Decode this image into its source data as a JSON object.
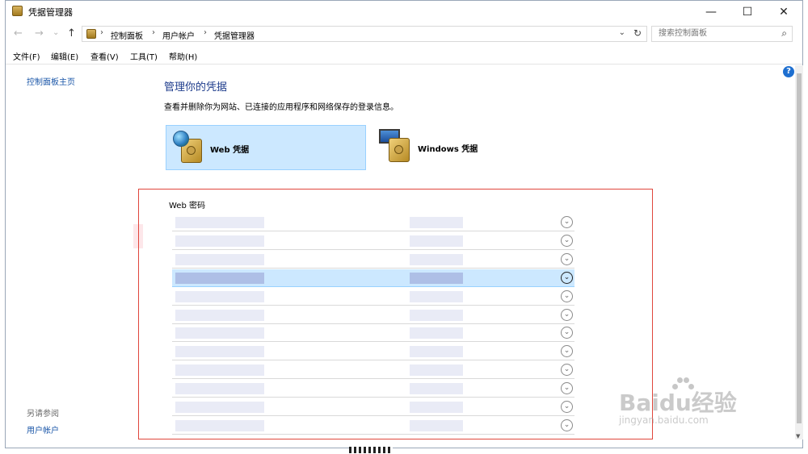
{
  "window": {
    "title": "凭据管理器",
    "controls": {
      "minimize": "—",
      "maximize": "☐",
      "close": "✕"
    }
  },
  "nav": {
    "back": "←",
    "forward": "→",
    "recent": "⌄",
    "up": "↑",
    "breadcrumbs": [
      "控制面板",
      "用户帐户",
      "凭据管理器"
    ],
    "separator": "›",
    "dropdown": "⌄",
    "refresh": "↻",
    "search_placeholder": "搜索控制面板",
    "search_icon": "⌕"
  },
  "menu": [
    "文件(F)",
    "编辑(E)",
    "查看(V)",
    "工具(T)",
    "帮助(H)"
  ],
  "sidebar": {
    "home": "控制面板主页",
    "see_also_title": "另请参阅",
    "see_also_links": [
      "用户帐户"
    ]
  },
  "main": {
    "title": "管理你的凭据",
    "description": "查看并删除你为网站、已连接的应用程序和网络保存的登录信息。",
    "tiles": [
      {
        "label": "Web 凭据",
        "selected": true,
        "icon": "globe-safe-icon"
      },
      {
        "label": "Windows 凭据",
        "selected": false,
        "icon": "monitor-safe-icon"
      }
    ],
    "list_title": "Web 密码",
    "rows": [
      {
        "selected": false
      },
      {
        "selected": false
      },
      {
        "selected": false
      },
      {
        "selected": true
      },
      {
        "selected": false
      },
      {
        "selected": false
      },
      {
        "selected": false
      },
      {
        "selected": false
      },
      {
        "selected": false
      },
      {
        "selected": false
      },
      {
        "selected": false
      },
      {
        "selected": false
      }
    ],
    "chevron": "⌄"
  },
  "help": "?",
  "watermark": {
    "brand": "Baidu经验",
    "url": "jingyan.baidu.com"
  },
  "colors": {
    "accent": "#1a56a8",
    "selected_bg": "#cce8ff",
    "annotation": "#e0463c"
  }
}
